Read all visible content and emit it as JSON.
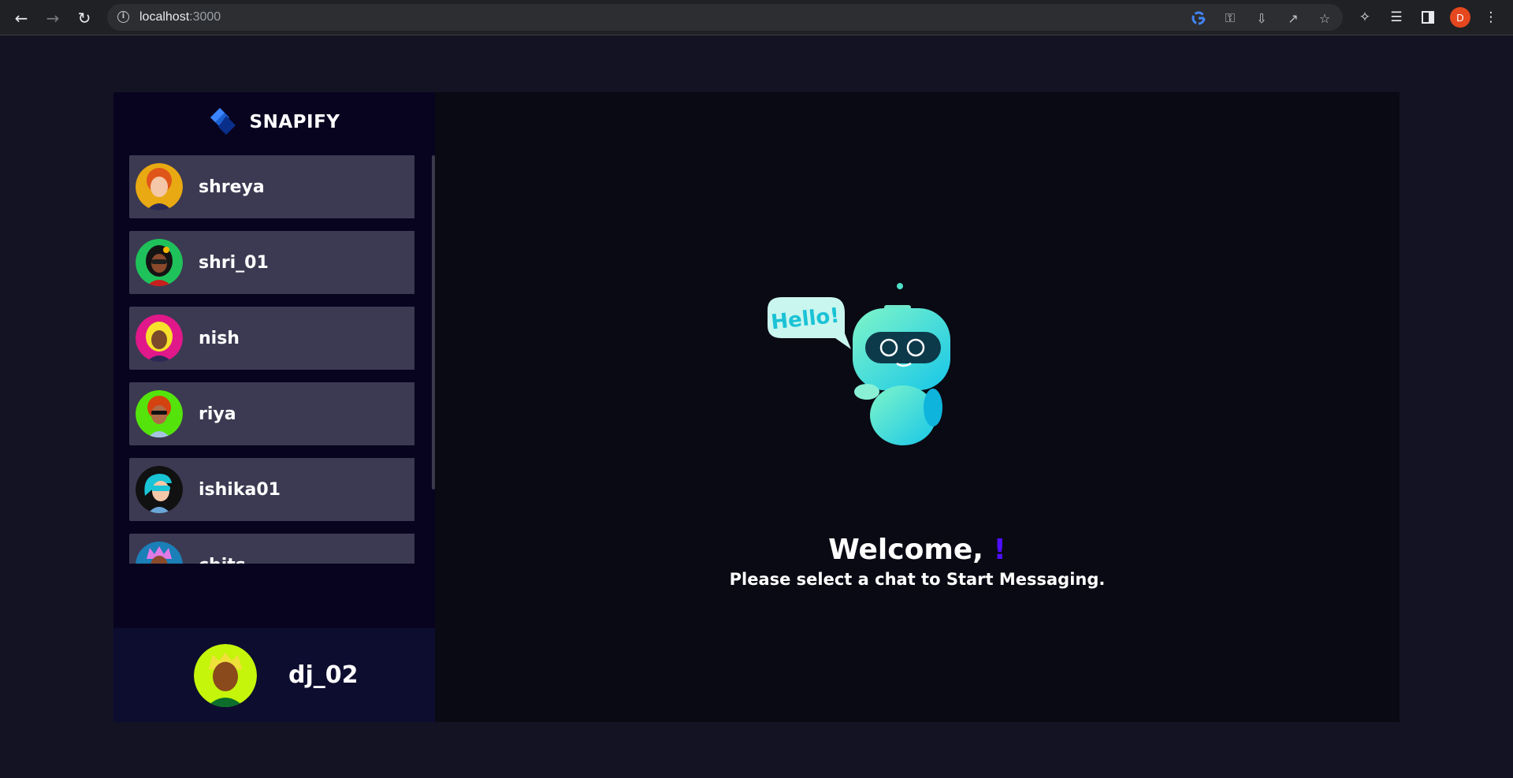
{
  "browser": {
    "url_host": "localhost",
    "url_port": ":3000",
    "profile_initial": "D"
  },
  "app": {
    "brand_name": "SNAPIFY",
    "contacts": [
      {
        "name": "shreya",
        "avatar_bg": "#e8a913"
      },
      {
        "name": "shri_01",
        "avatar_bg": "#1fc25a"
      },
      {
        "name": "nish",
        "avatar_bg": "#e0188a"
      },
      {
        "name": "riya",
        "avatar_bg": "#54e40c"
      },
      {
        "name": "ishika01",
        "avatar_bg": "#111111"
      },
      {
        "name": "chits",
        "avatar_bg": "#1b7fb8"
      },
      {
        "name": "",
        "avatar_bg": "#e0188a"
      }
    ],
    "current_user": {
      "name": "dj_02",
      "avatar_bg": "#c4f50a"
    },
    "welcome": {
      "greeting": "Welcome,",
      "exclaim": "!",
      "subtitle": "Please select a chat to Start Messaging.",
      "bubble_text": "Hello!"
    }
  },
  "colors": {
    "accent": "#4e0eff",
    "sidebar_bg": "#080420",
    "contact_bg": "#3c3a52",
    "page_bg": "#131324"
  }
}
